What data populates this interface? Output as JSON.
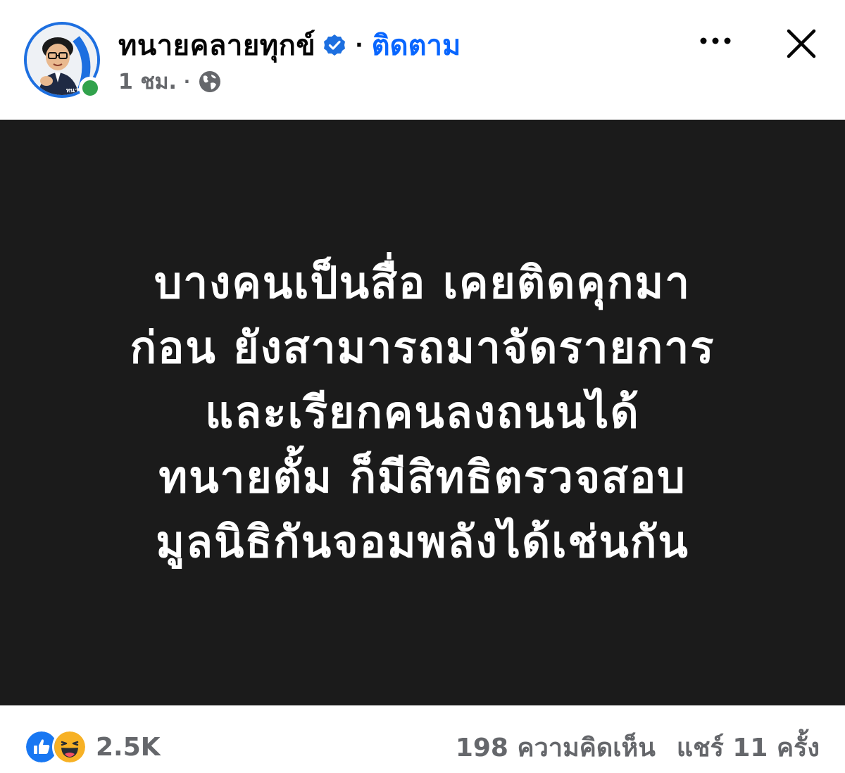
{
  "header": {
    "page_name": "ทนายคลายทุกข์",
    "separator": "·",
    "follow_label": "ติดตาม",
    "time": "1 ชม.",
    "time_separator": "·",
    "avatar_caption": "ทนายคลายทุกข์"
  },
  "post": {
    "lines": [
      "บางคนเป็นสื่อ เคยติดคุกมา",
      "ก่อน ยังสามารถมาจัดรายการ",
      "และเรียกคนลงถนนได้",
      "ทนายตั้ม ก็มีสิทธิตรวจสอบ",
      "มูลนิธิกันจอมพลังได้เช่นกัน"
    ],
    "background_color": "#1b1b1b",
    "text_color": "#ffffff"
  },
  "footer": {
    "reaction_count": "2.5K",
    "comments": "198 ความคิดเห็น",
    "shares": "แชร์ 11 ครั้ง",
    "reaction_icons": [
      "like-icon",
      "haha-icon"
    ]
  },
  "colors": {
    "accent": "#0866ff",
    "verified": "#1d6fe0",
    "online": "#31a24c",
    "secondary_text": "#65676b"
  }
}
